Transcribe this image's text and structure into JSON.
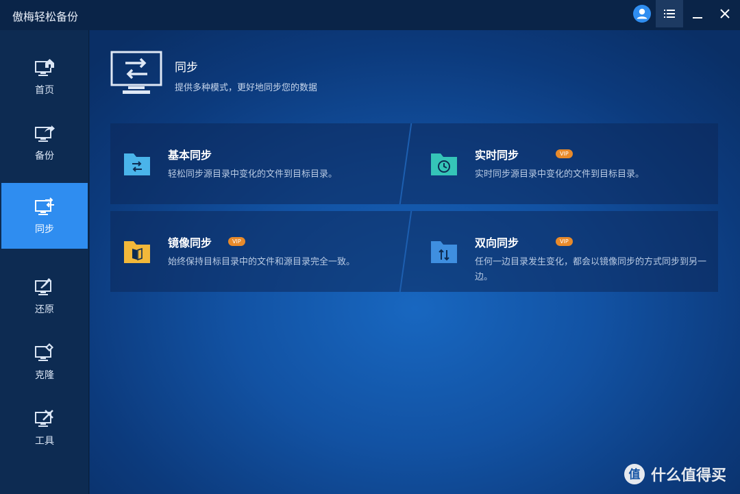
{
  "app": {
    "title": "傲梅轻松备份"
  },
  "sidebar": {
    "items": [
      {
        "label": "首页",
        "icon": "home-monitor-icon",
        "active": false
      },
      {
        "label": "备份",
        "icon": "backup-monitor-icon",
        "active": false
      },
      {
        "label": "同步",
        "icon": "sync-monitor-icon",
        "active": true
      },
      {
        "label": "还原",
        "icon": "restore-monitor-icon",
        "active": false
      },
      {
        "label": "克隆",
        "icon": "clone-monitor-icon",
        "active": false
      },
      {
        "label": "工具",
        "icon": "tools-monitor-icon",
        "active": false
      }
    ]
  },
  "header": {
    "title": "同步",
    "subtitle": "提供多种模式，更好地同步您的数据"
  },
  "cards": [
    {
      "title": "基本同步",
      "desc": "轻松同步源目录中变化的文件到目标目录。",
      "vip": "",
      "icon": "basic-sync-folder-icon",
      "color": "#4ab4ea"
    },
    {
      "title": "实时同步",
      "desc": "实时同步源目录中变化的文件到目标目录。",
      "vip": "VIP",
      "icon": "realtime-sync-clock-icon",
      "color": "#35c5b8"
    },
    {
      "title": "镜像同步",
      "desc": "始终保持目标目录中的文件和源目录完全一致。",
      "vip": "VIP",
      "icon": "mirror-sync-folder-icon",
      "color": "#f2b83a"
    },
    {
      "title": "双向同步",
      "desc": "任何一边目录发生变化，都会以镜像同步的方式同步到另一边。",
      "vip": "VIP",
      "icon": "two-way-sync-folder-icon",
      "color": "#3f8fe0"
    }
  ],
  "watermark": {
    "text": "什么值得买"
  },
  "colors": {
    "accent": "#2f8df0",
    "vip": "#e88a2a",
    "sidebar": "#0d2b52",
    "titlebar": "#0a2448"
  }
}
